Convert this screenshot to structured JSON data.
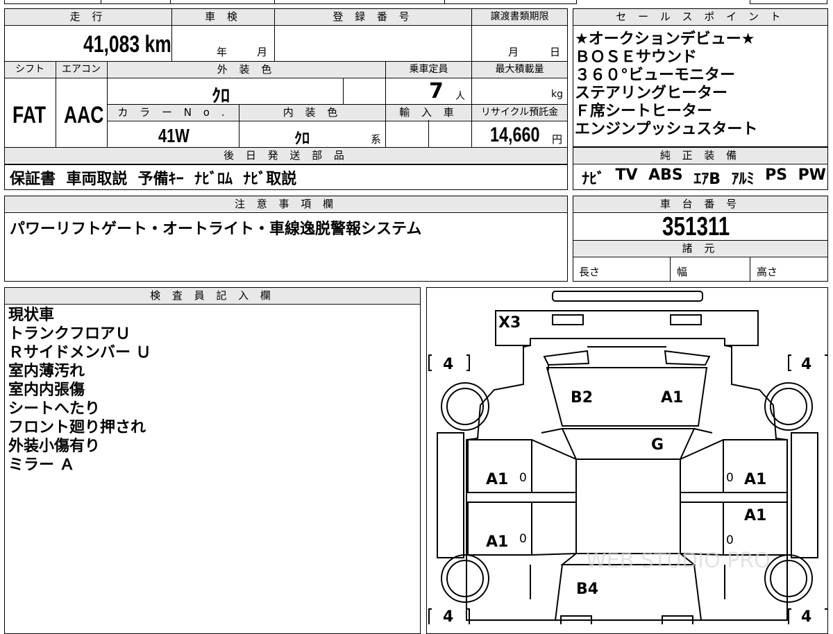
{
  "top_strip": {
    "fragments": [
      "",
      "",
      "",
      "",
      ""
    ]
  },
  "main_info": {
    "headers": {
      "mileage": "走 行",
      "shaken": "車 検",
      "registration": "登 録 番 号",
      "transfer_deadline": "譲渡書類期限",
      "shift": "シフト",
      "aircon": "エアコン",
      "exterior_color": "外 装 色",
      "capacity": "乗車定員",
      "max_load": "最大積載量",
      "color_no": "カ ラ ー N o .",
      "interior_color": "内 装 色",
      "import": "輸 入 車",
      "recycle": "リサイクル預託金"
    },
    "mileage_value": "41,083 km",
    "shaken_year_unit": "年",
    "shaken_month_unit": "月",
    "transfer_month_unit": "月",
    "transfer_day_unit": "日",
    "shift_value": "FAT",
    "aircon_value": "AAC",
    "exterior_color_value": "ｸﾛ",
    "capacity_value": "7",
    "capacity_unit": "人",
    "max_load_unit": "kg",
    "color_no_value": "41W",
    "interior_color_value": "ｸﾛ",
    "interior_color_suffix": "系",
    "recycle_value": "14,660",
    "recycle_unit": "円"
  },
  "later_parts": {
    "header": "後 日 発 送 部 品",
    "value": "保証書  車両取説  予備ｷｰ  ﾅﾋﾞﾛﾑ  ﾅﾋﾞ取説"
  },
  "notes": {
    "header": "注 意 事 項 欄",
    "value": "パワーリフトゲート・オートライト・車線逸脱警報システム"
  },
  "sales_points": {
    "header": "セ ー ル ス ポ イ ン ト",
    "items": [
      "★オークションデビュー★",
      "ＢＯＳＥサウンド",
      "３６０°ビューモニター",
      "ステアリングヒーター",
      "Ｆ席シートヒーター",
      "エンジンプッシュスタート"
    ]
  },
  "genuine_equipment": {
    "header": "純 正 装 備",
    "items": [
      "ﾅﾋﾞ",
      "TV",
      "ABS",
      "ｴｱB",
      "ｱﾙﾐ",
      "PS",
      "PW"
    ]
  },
  "chassis": {
    "header": "車 台 番 号",
    "value": "351311"
  },
  "specs": {
    "header": "諸 元",
    "length": "長さ",
    "width": "幅",
    "height": "高さ"
  },
  "inspector": {
    "header": "検 査 員 記 入 欄",
    "lines": [
      "現状車",
      "トランクフロアＵ",
      "Ｒサイドメンバー Ｕ",
      "室内薄汚れ",
      "室内内張傷",
      "シートへたり",
      "フロント廻り押され",
      "外装小傷有り",
      "ミラー Ａ"
    ]
  },
  "diagram": {
    "tires": {
      "front_left": "4",
      "front_right": "4",
      "rear_left": "4",
      "rear_right": "4"
    },
    "marks": {
      "rear_bumper": "X3",
      "trunk_left": "B2",
      "trunk_right": "A1",
      "rear_glass": "G",
      "left_rear_door": "A1",
      "left_front_door": "A1",
      "right_rear_door": "A1",
      "right_front_door": "A1",
      "hood": "B4"
    },
    "zero_marks": [
      "0",
      "0",
      "0",
      "0"
    ],
    "watermark": "WEB STUDIO PRO"
  }
}
